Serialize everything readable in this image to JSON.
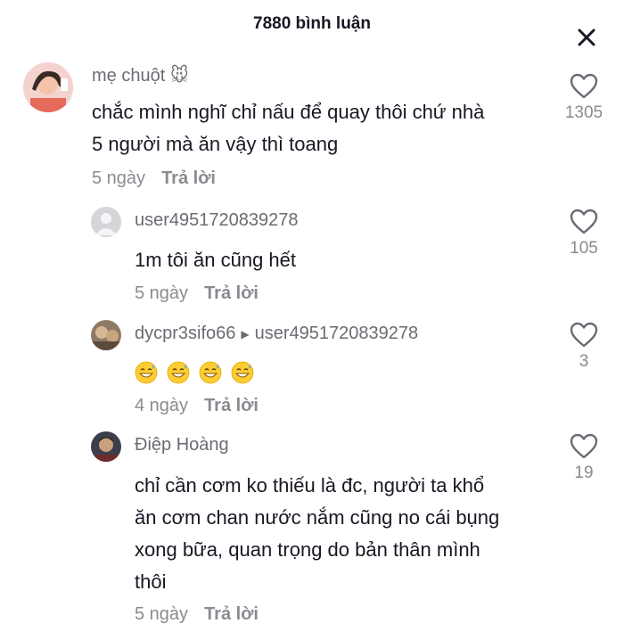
{
  "header": {
    "title": "7880 bình luận"
  },
  "comments": [
    {
      "author": "mẹ chuột 🐭",
      "text_lines": [
        "chắc mình nghĩ chỉ nấu để quay thôi chứ nhà",
        "5 người mà ăn vậy thì toang"
      ],
      "time": "5 ngày",
      "reply_label": "Trả lời",
      "likes": "1305"
    },
    {
      "author": "user4951720839278",
      "text_lines": [
        "1m tôi ăn cũng hết"
      ],
      "time": "5 ngày",
      "reply_label": "Trả lời",
      "likes": "105"
    },
    {
      "author": "dycpr3sifo66",
      "reply_to": "user4951720839278",
      "emoji_count": 4,
      "emoji": "grinning-sweat-face",
      "time": "4 ngày",
      "reply_label": "Trả lời",
      "likes": "3"
    },
    {
      "author": "Điệp Hoàng",
      "text_lines": [
        "chỉ cần cơm ko thiếu là đc, người ta khổ",
        "ăn cơm chan nước nắm cũng no cái bụng",
        "xong bữa, quan trọng do bản thân mình",
        "thôi"
      ],
      "time": "5 ngày",
      "reply_label": "Trả lời",
      "likes": "19"
    }
  ],
  "icons": {
    "close": "close-icon",
    "like": "heart-outline-icon",
    "reply_arrow": "triangle-right-icon"
  }
}
